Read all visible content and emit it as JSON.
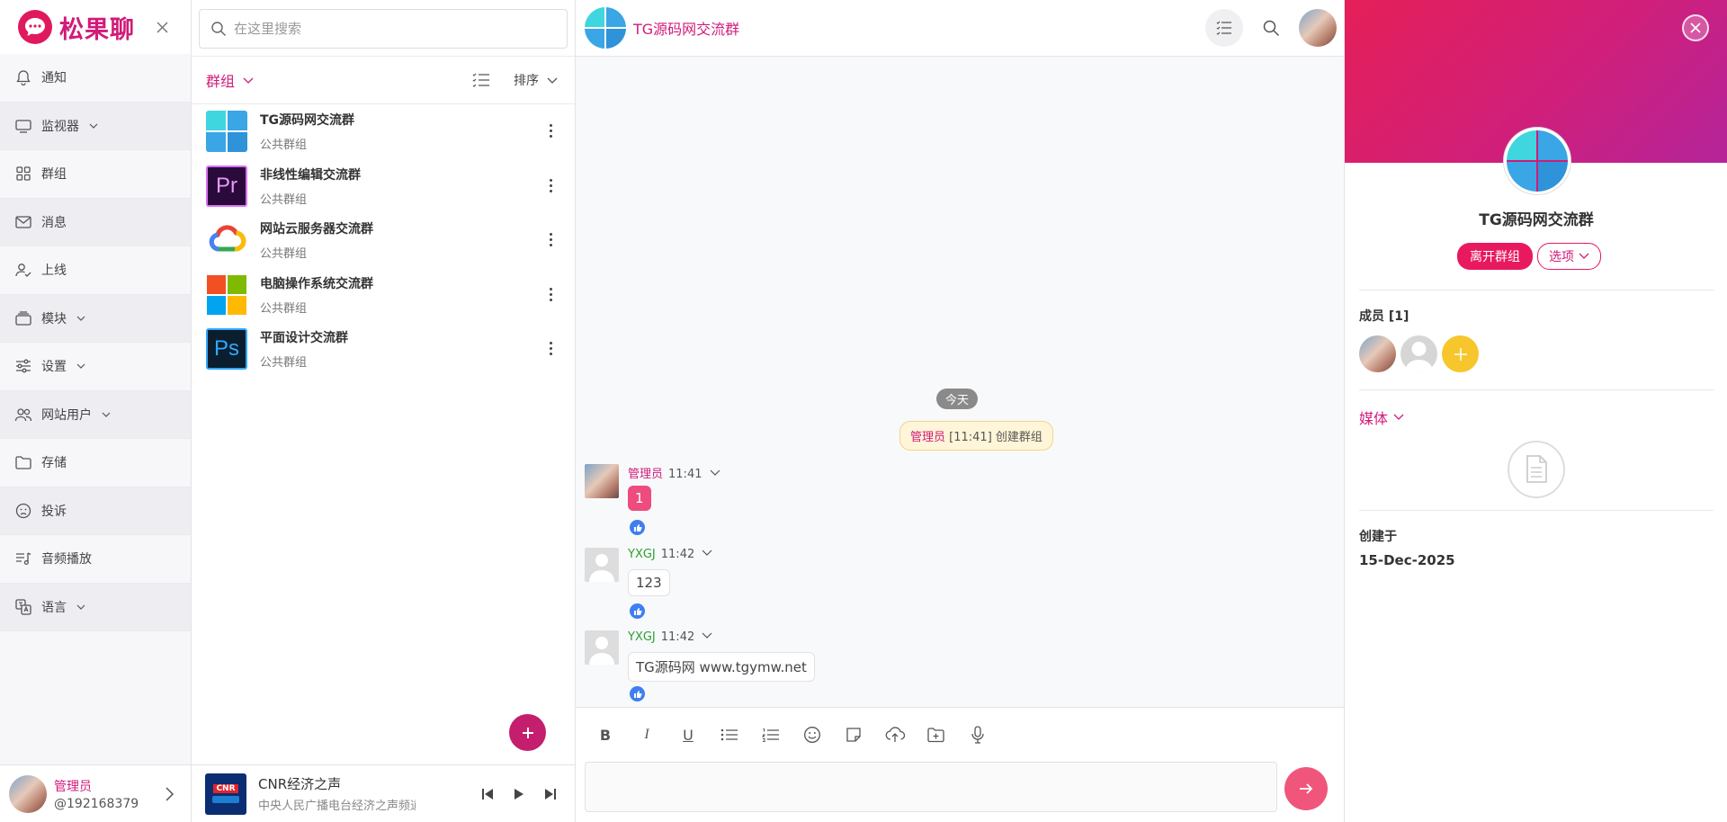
{
  "brand": {
    "name": "松果聊"
  },
  "sidebar": {
    "items": [
      {
        "label": "通知",
        "icon": "bell-icon"
      },
      {
        "label": "监视器",
        "icon": "monitor-icon",
        "dropdown": true
      },
      {
        "label": "群组",
        "icon": "grid-icon"
      },
      {
        "label": "消息",
        "icon": "mail-icon"
      },
      {
        "label": "上线",
        "icon": "user-check-icon"
      },
      {
        "label": "模块",
        "icon": "layers-icon",
        "dropdown": true
      },
      {
        "label": "设置",
        "icon": "sliders-icon",
        "dropdown": true
      },
      {
        "label": "网站用户",
        "icon": "users-icon",
        "dropdown": true
      },
      {
        "label": "存储",
        "icon": "folder-icon"
      },
      {
        "label": "投诉",
        "icon": "frown-icon"
      },
      {
        "label": "音频播放",
        "icon": "music-list-icon"
      },
      {
        "label": "语言",
        "icon": "translate-icon",
        "dropdown": true
      }
    ],
    "user": {
      "name": "管理员",
      "id": "@192168379"
    }
  },
  "list": {
    "search_placeholder": "在这里搜索",
    "title": "群组",
    "sort_label": "排序",
    "groups": [
      {
        "name": "TG源码网交流群",
        "type": "公共群组",
        "icon": "tg-icon"
      },
      {
        "name": "非线性编辑交流群",
        "type": "公共群组",
        "icon": "premiere-icon",
        "icon_text": "Pr"
      },
      {
        "name": "网站云服务器交流群",
        "type": "公共群组",
        "icon": "cloud-icon"
      },
      {
        "name": "电脑操作系统交流群",
        "type": "公共群组",
        "icon": "windows-icon"
      },
      {
        "name": "平面设计交流群",
        "type": "公共群组",
        "icon": "photoshop-icon",
        "icon_text": "Ps"
      }
    ]
  },
  "player": {
    "title": "CNR经济之声",
    "subtitle": "中央人民广播电台经济之声频道",
    "logo_text": "CNR"
  },
  "chat": {
    "title": "TG源码网交流群",
    "date_chip": "今天",
    "system_msg": {
      "user": "管理员",
      "time": "[11:41]",
      "text": "创建群组"
    },
    "messages": [
      {
        "sender": "管理员",
        "time": "11:41",
        "text": "1",
        "style": "pink"
      },
      {
        "sender": "YXGJ",
        "time": "11:42",
        "text": "123",
        "style": "normal"
      },
      {
        "sender": "YXGJ",
        "time": "11:42",
        "text": "TG源码网 www.tgymw.net",
        "style": "normal"
      }
    ],
    "toolbar": [
      {
        "label": "B",
        "icon": "bold-icon"
      },
      {
        "label": "I",
        "icon": "italic-icon"
      },
      {
        "label": "U",
        "icon": "underline-icon"
      },
      {
        "label": "",
        "icon": "bullet-list-icon"
      },
      {
        "label": "",
        "icon": "numbered-list-icon"
      },
      {
        "label": "",
        "icon": "emoji-icon"
      },
      {
        "label": "",
        "icon": "sticker-icon"
      },
      {
        "label": "",
        "icon": "upload-cloud-icon"
      },
      {
        "label": "",
        "icon": "folder-add-icon"
      },
      {
        "label": "",
        "icon": "microphone-icon"
      }
    ]
  },
  "info": {
    "title": "TG源码网交流群",
    "leave_label": "离开群组",
    "options_label": "选项",
    "members_label": "成员 [1]",
    "media_label": "媒体",
    "created_label": "创建于",
    "created_date": "15-Dec-2025"
  },
  "colors": {
    "accent": "#d11b7a",
    "cover_start": "#e51f58",
    "cover_end": "#b4249a",
    "send": "#f0567b"
  }
}
